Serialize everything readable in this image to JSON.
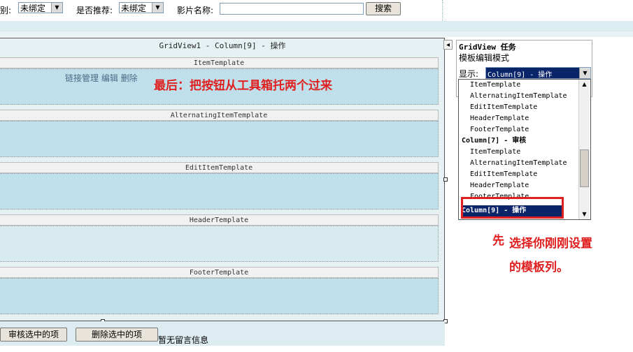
{
  "filter": {
    "category_label": "别:",
    "category_value": "未绑定",
    "recommend_label": "是否推荐:",
    "recommend_value": "未绑定",
    "movie_name_label": "影片名称:",
    "search_button": "搜索"
  },
  "gridview": {
    "header": "GridView1 - Column[9] - 操作",
    "templates": {
      "item": "ItemTemplate",
      "alternating": "AlternatingItemTemplate",
      "edit": "EditItemTemplate",
      "header": "HeaderTemplate",
      "footer": "FooterTemplate"
    },
    "item_links": "链接管理 编辑 删除"
  },
  "annotations": {
    "last_step": "最后：把按钮从工具箱托两个过来",
    "first_prefix": "先",
    "first_line1": "选择你刚刚设置",
    "first_line2": "的模板列。"
  },
  "tasks": {
    "title": "GridView 任务",
    "subtitle": "模板编辑模式",
    "display_label": "显示:",
    "display_value": "Column[9] - 操作",
    "list": [
      {
        "type": "item",
        "text": "ItemTemplate"
      },
      {
        "type": "item",
        "text": "AlternatingItemTemplate"
      },
      {
        "type": "item",
        "text": "EditItemTemplate"
      },
      {
        "type": "item",
        "text": "HeaderTemplate"
      },
      {
        "type": "item",
        "text": "FooterTemplate"
      },
      {
        "type": "group",
        "text": "Column[7] - 审核"
      },
      {
        "type": "item",
        "text": "ItemTemplate"
      },
      {
        "type": "item",
        "text": "AlternatingItemTemplate"
      },
      {
        "type": "item",
        "text": "EditItemTemplate"
      },
      {
        "type": "item",
        "text": "HeaderTemplate"
      },
      {
        "type": "item",
        "text": "FooterTemplate"
      },
      {
        "type": "group",
        "text": "Column[9] - 操作",
        "selected": true
      }
    ]
  },
  "bottom": {
    "approve_button": "审核选中的项",
    "delete_button": "删除选中的项",
    "empty_message": "暂无留言信息"
  },
  "colors": {
    "annotation": "#e02020",
    "selected_row": "#0a246a",
    "template_body": "#bfe0ea"
  }
}
